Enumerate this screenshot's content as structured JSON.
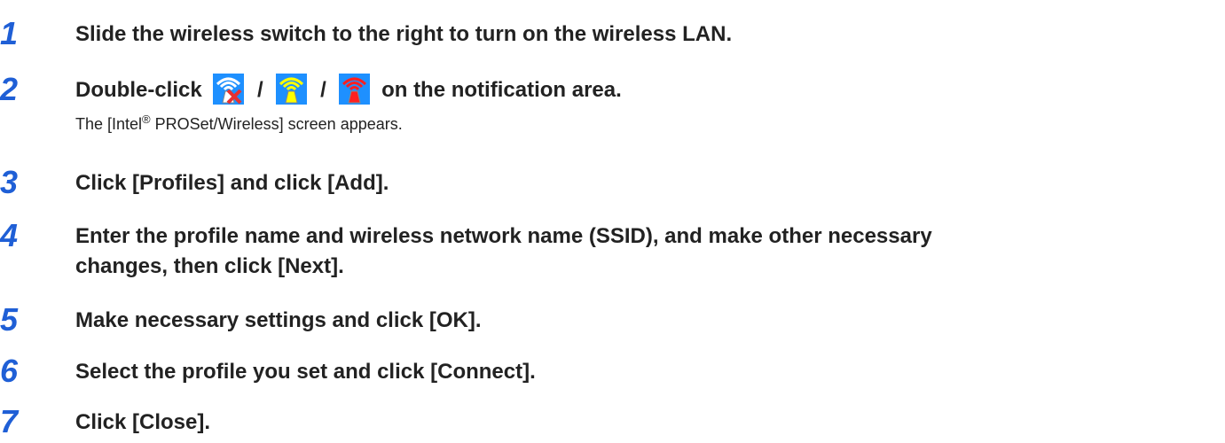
{
  "steps": [
    {
      "number": "1",
      "text": "Slide the wireless switch to the right to turn on the wireless LAN."
    },
    {
      "number": "2",
      "prefix": "Double-click",
      "separator": "/",
      "suffix": "on the notification area.",
      "icons": [
        "wireless-off-icon",
        "wireless-searching-icon",
        "wireless-disconnected-icon"
      ],
      "sub_prefix": "The [Intel",
      "sub_sup": "®",
      "sub_suffix": " PROSet/Wireless] screen appears."
    },
    {
      "number": "3",
      "text": "Click [Profiles] and click [Add]."
    },
    {
      "number": "4",
      "line1": "Enter the profile name and wireless network name (SSID), and make other necessary",
      "line2": "changes, then click [Next]."
    },
    {
      "number": "5",
      "text": "Make necessary settings and click [OK]."
    },
    {
      "number": "6",
      "text": "Select the profile you set and click [Connect]."
    },
    {
      "number": "7",
      "text": "Click [Close]."
    }
  ],
  "colors": {
    "step_number": "#1f5fd6",
    "icon_background": "#1e90ff",
    "icon_white_tower": "#ffffff",
    "icon_yellow_tower": "#ffff00",
    "icon_red_tower": "#ff2020",
    "icon_x": "#e83030"
  }
}
